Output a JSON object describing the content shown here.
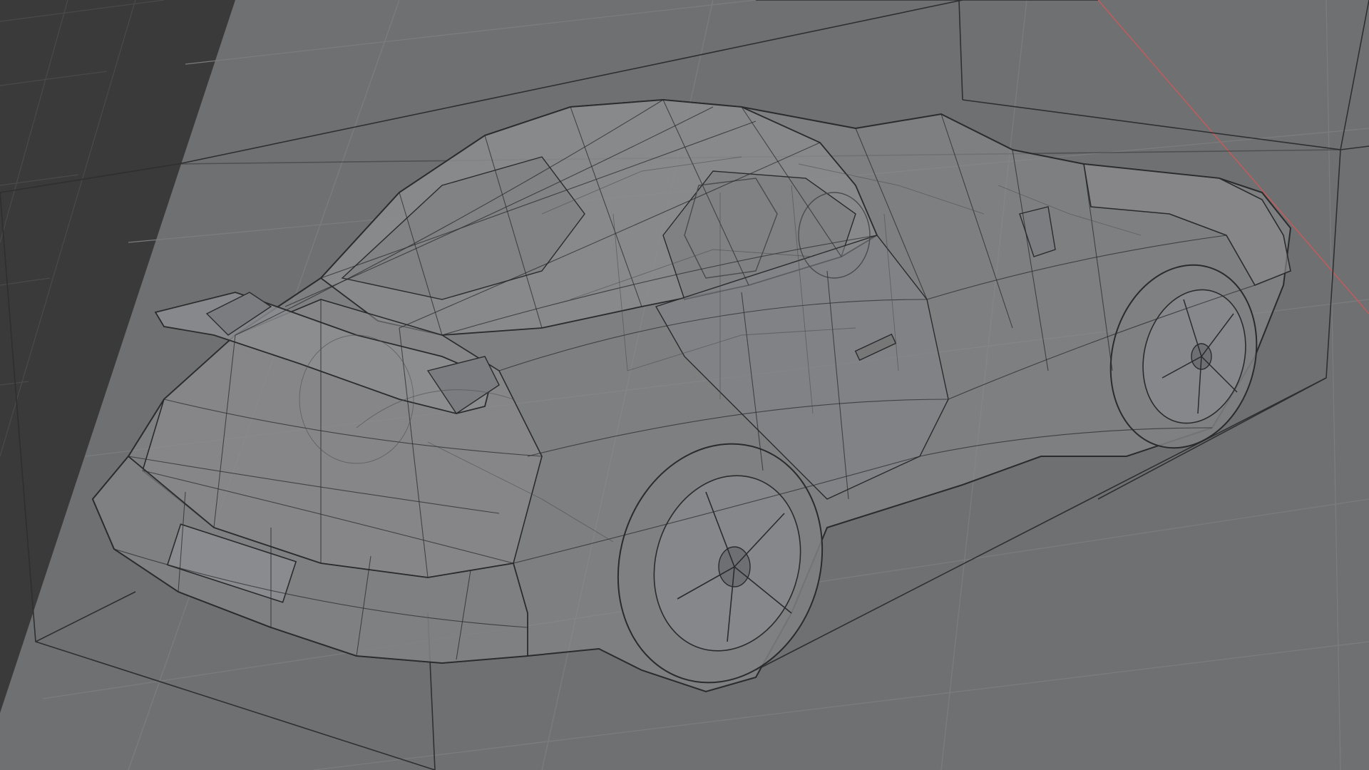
{
  "viewport": {
    "mode": "3d-viewport",
    "shading": "wireframe-xray",
    "object": "car-model",
    "colors": {
      "background": "#6f7072",
      "outside_area": "#3a3a3a",
      "grid_line": "#7b7c7e",
      "wire": "#2a2b2d",
      "wire_faint": "#4a4b4d",
      "surface": "#8b8c8e",
      "surface_dark": "#7c7d80",
      "x_axis": "#c25b5b",
      "bounds": "#2e2f31"
    }
  }
}
